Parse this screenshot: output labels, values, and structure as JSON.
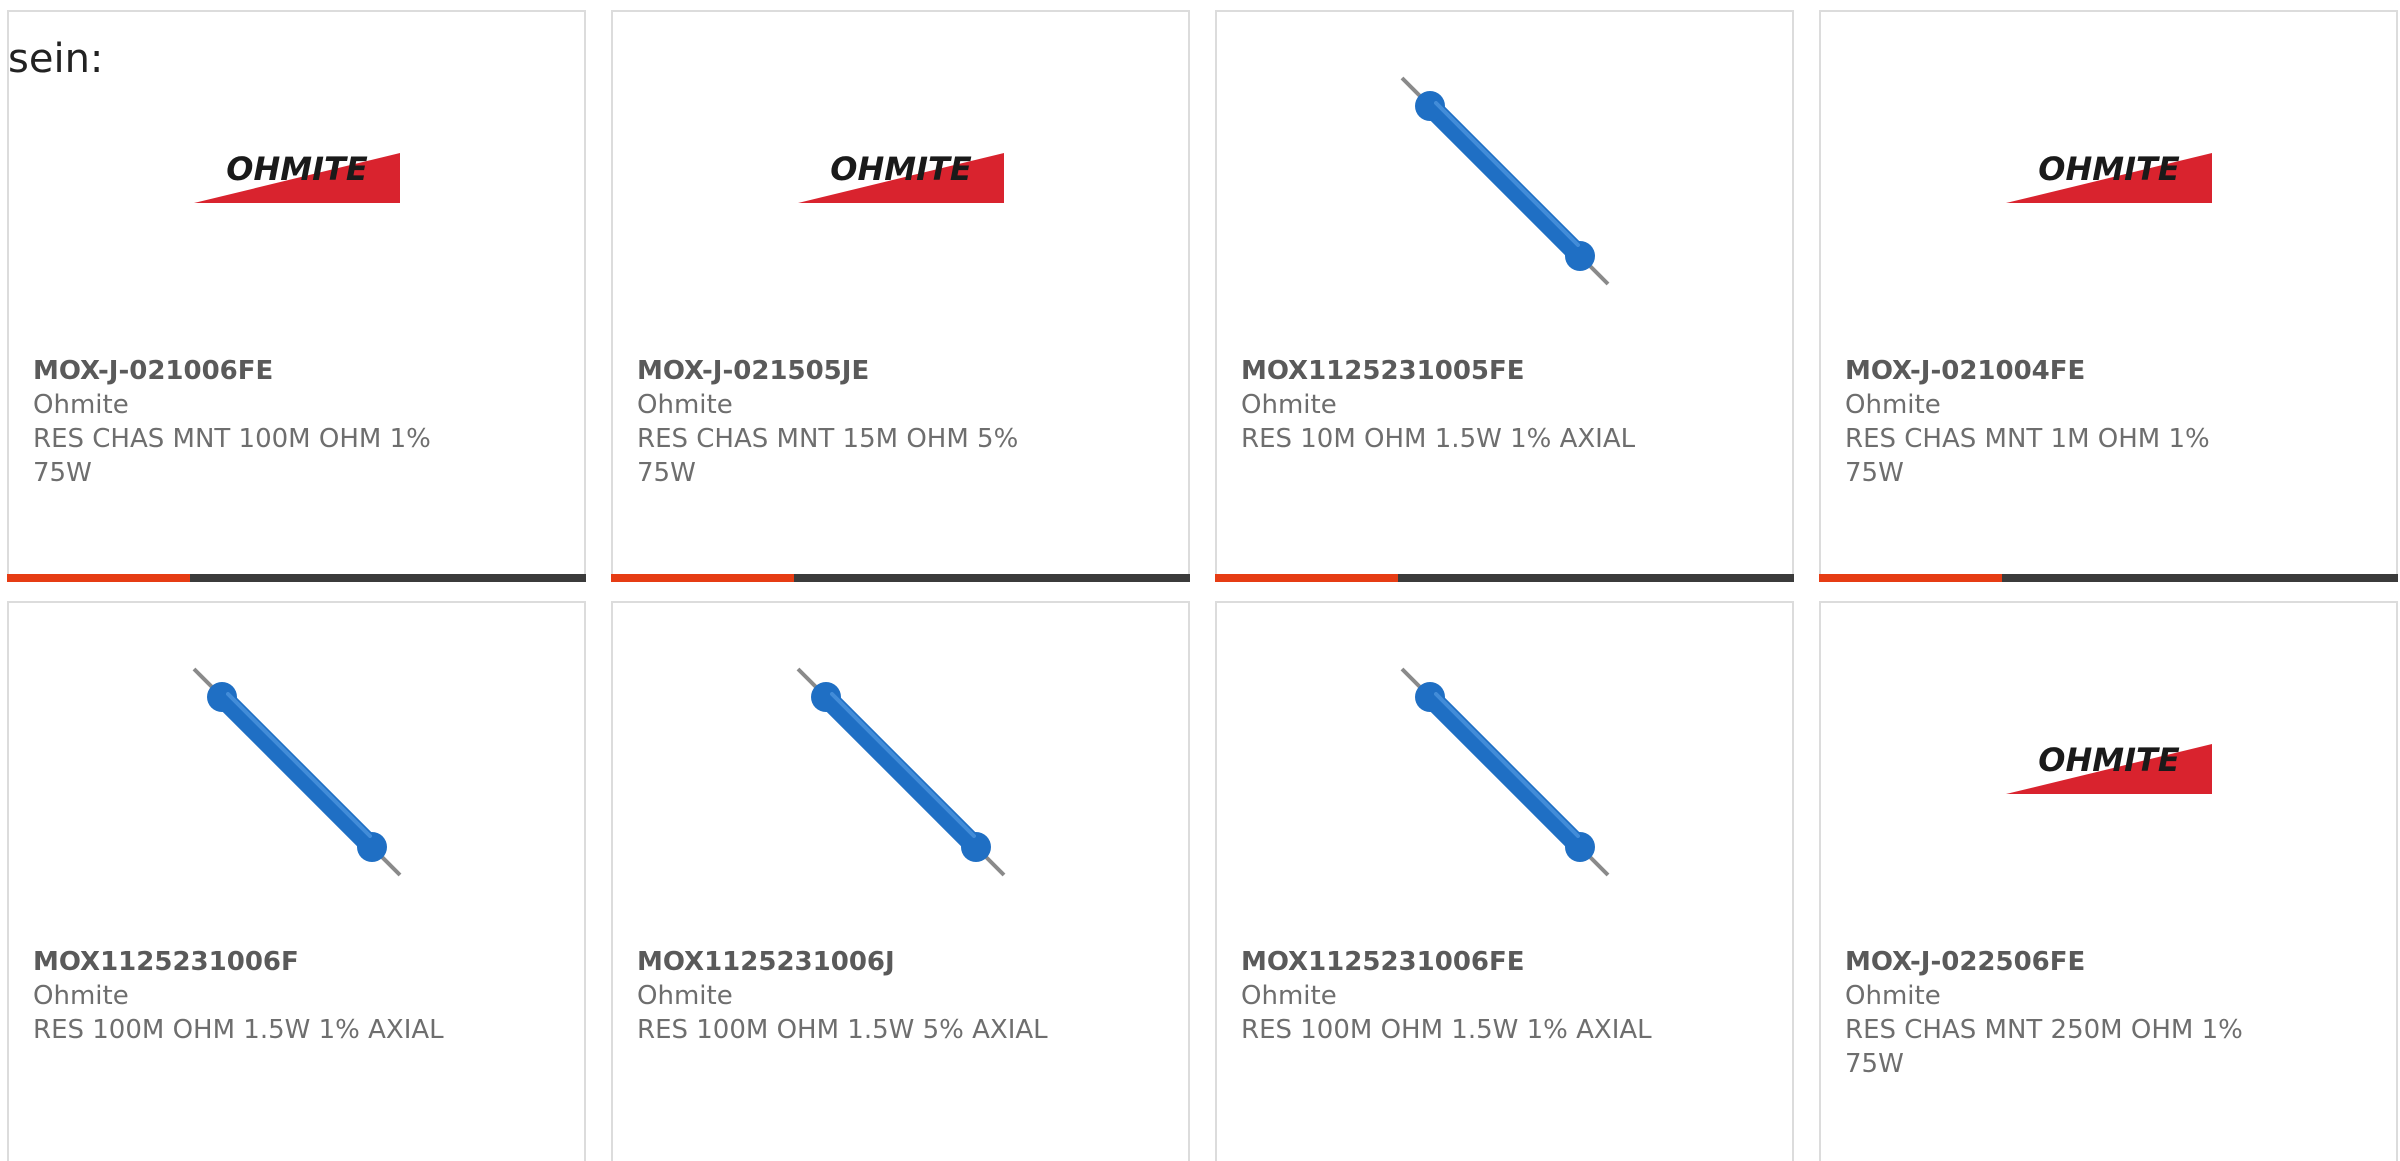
{
  "intro_text": "sein:",
  "colors": {
    "accent_bar": "#e63c14",
    "bar": "#3b3b3b",
    "border": "#dcdcdc",
    "logo_red": "#d9232e",
    "resistor_blue": "#1f6fc4"
  },
  "logo_text": "OHMITE",
  "products": [
    {
      "part": "MOX-J-021006FE",
      "manufacturer": "Ohmite",
      "description": "RES CHAS MNT 100M OHM 1% 75W",
      "image": "ohmite-logo"
    },
    {
      "part": "MOX-J-021505JE",
      "manufacturer": "Ohmite",
      "description": "RES CHAS MNT 15M OHM 5% 75W",
      "image": "ohmite-logo"
    },
    {
      "part": "MOX1125231005FE",
      "manufacturer": "Ohmite",
      "description": "RES 10M OHM 1.5W 1% AXIAL",
      "image": "axial-resistor"
    },
    {
      "part": "MOX-J-021004FE",
      "manufacturer": "Ohmite",
      "description": "RES CHAS MNT 1M OHM 1% 75W",
      "image": "ohmite-logo"
    },
    {
      "part": "MOX1125231006F",
      "manufacturer": "Ohmite",
      "description": "RES 100M OHM 1.5W 1% AXIAL",
      "image": "axial-resistor"
    },
    {
      "part": "MOX1125231006J",
      "manufacturer": "Ohmite",
      "description": "RES 100M OHM 1.5W 5% AXIAL",
      "image": "axial-resistor"
    },
    {
      "part": "MOX1125231006FE",
      "manufacturer": "Ohmite",
      "description": "RES 100M OHM 1.5W 1% AXIAL",
      "image": "axial-resistor"
    },
    {
      "part": "MOX-J-022506FE",
      "manufacturer": "Ohmite",
      "description": "RES CHAS MNT 250M OHM 1% 75W",
      "image": "ohmite-logo"
    }
  ]
}
